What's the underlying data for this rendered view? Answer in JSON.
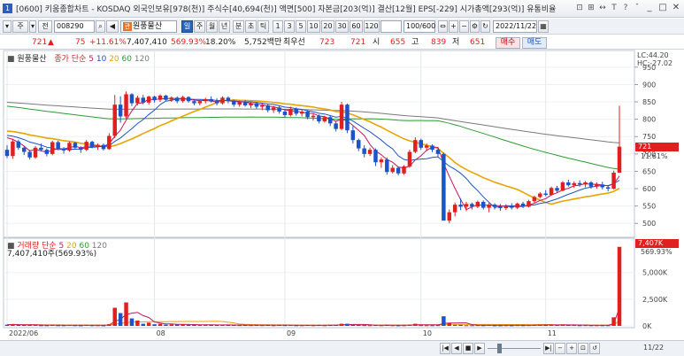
{
  "window": {
    "app_num": "1",
    "title": "[0600] 키움종합차트 - KOSDAQ 외국인보유[978(천)]  주식수[40,694(천)]  액면[500]  자본금[203(억)]  결산[12월]  EPS[-229]  시가총액[293(억)]  유통비율",
    "ctrl_icons": [
      "⊡",
      "⊞",
      "↔",
      "T",
      "?",
      "ˇ"
    ],
    "win_buttons": [
      "_",
      "□",
      "✕"
    ]
  },
  "toolbar": {
    "type_btn": "주",
    "prev_btn": "전",
    "code": "008290",
    "stock_badge": "관",
    "stock_name": "원풍물산",
    "periods": [
      "일",
      "주",
      "월",
      "년",
      "분",
      "초",
      "틱"
    ],
    "active_period": "일",
    "intervals": [
      "1",
      "3",
      "5",
      "10",
      "20",
      "30",
      "60",
      "120"
    ],
    "count": "100/600",
    "date": "2022/11/22"
  },
  "quote": {
    "price": "721",
    "arrow": "▲",
    "change": "75",
    "change_pct": "+11.61%",
    "volume": "7,407,410",
    "volume_pct": "569.93%",
    "turnover": "18.20%",
    "amount": "5,752백만",
    "priority": "최우선",
    "ask": "723",
    "bid": "721",
    "open_label": "시",
    "open": "655",
    "high_label": "고",
    "high": "839",
    "low_label": "저",
    "low": "651",
    "buy_btn": "매수",
    "sell_btn": "매도"
  },
  "price_panel": {
    "stock_label": "원풍물산",
    "legend_prefix": "종가 단순",
    "ma_periods": [
      "5",
      "10",
      "20",
      "60",
      "120"
    ],
    "lc": "LC:44.20",
    "hc": "HC:-27.02",
    "current_tag": "721",
    "current_pct": "11.61%",
    "y_ticks": [
      "950",
      "900",
      "850",
      "800",
      "750",
      "700",
      "650",
      "600",
      "550",
      "500"
    ]
  },
  "volume_panel": {
    "legend_prefix": "거래량 단순",
    "ma_periods": [
      "5",
      "20",
      "60",
      "120"
    ],
    "value_line": "7,407,410주(569.93%)",
    "current_tag": "7,407K",
    "current_pct": "569.93%",
    "y_ticks": [
      "5,000K",
      "2,500K",
      "0K"
    ]
  },
  "x_axis": {
    "labels": [
      {
        "text": "2022/06",
        "idx": 0
      },
      {
        "text": "08",
        "idx": 26
      },
      {
        "text": "09",
        "idx": 49
      },
      {
        "text": "10",
        "idx": 73
      },
      {
        "text": "11",
        "idx": 95
      }
    ],
    "right_label": "11/22"
  },
  "colors": {
    "up": "#e02020",
    "down": "#1b53c8",
    "ma5": "#c2185b",
    "ma10": "#1b53c8",
    "ma20": "#e8a400",
    "ma60": "#2e9b34",
    "ma120": "#7a7a7a"
  },
  "chart_data": {
    "type": "candlestick",
    "ylim": [
      470,
      970
    ],
    "volume_ylim": [
      0,
      7800000
    ],
    "ohlc": [
      [
        712,
        725,
        688,
        694
      ],
      [
        694,
        744,
        686,
        736
      ],
      [
        736,
        741,
        712,
        718
      ],
      [
        718,
        722,
        697,
        706
      ],
      [
        706,
        712,
        684,
        690
      ],
      [
        690,
        723,
        686,
        718
      ],
      [
        718,
        730,
        708,
        712
      ],
      [
        712,
        716,
        693,
        700
      ],
      [
        700,
        738,
        696,
        734
      ],
      [
        734,
        738,
        712,
        716
      ],
      [
        716,
        720,
        701,
        710
      ],
      [
        710,
        736,
        706,
        732
      ],
      [
        732,
        735,
        714,
        718
      ],
      [
        718,
        722,
        703,
        712
      ],
      [
        712,
        740,
        708,
        735
      ],
      [
        735,
        738,
        716,
        720
      ],
      [
        720,
        730,
        712,
        726
      ],
      [
        726,
        730,
        710,
        714
      ],
      [
        714,
        760,
        712,
        752
      ],
      [
        752,
        870,
        745,
        842
      ],
      [
        842,
        866,
        790,
        808
      ],
      [
        808,
        880,
        802,
        872
      ],
      [
        872,
        875,
        838,
        846
      ],
      [
        846,
        868,
        840,
        862
      ],
      [
        862,
        870,
        843,
        848
      ],
      [
        848,
        868,
        842,
        865
      ],
      [
        865,
        868,
        848,
        856
      ],
      [
        856,
        872,
        850,
        868
      ],
      [
        868,
        871,
        852,
        856
      ],
      [
        856,
        866,
        850,
        862
      ],
      [
        862,
        866,
        846,
        852
      ],
      [
        852,
        868,
        848,
        864
      ],
      [
        864,
        866,
        848,
        852
      ],
      [
        852,
        858,
        840,
        846
      ],
      [
        846,
        856,
        840,
        852
      ],
      [
        852,
        862,
        846,
        858
      ],
      [
        858,
        866,
        848,
        852
      ],
      [
        852,
        860,
        840,
        846
      ],
      [
        846,
        866,
        842,
        862
      ],
      [
        862,
        866,
        846,
        852
      ],
      [
        852,
        856,
        836,
        842
      ],
      [
        842,
        854,
        836,
        850
      ],
      [
        850,
        855,
        836,
        840
      ],
      [
        840,
        850,
        832,
        846
      ],
      [
        846,
        850,
        830,
        836
      ],
      [
        836,
        846,
        826,
        840
      ],
      [
        840,
        844,
        820,
        826
      ],
      [
        826,
        838,
        818,
        834
      ],
      [
        834,
        840,
        816,
        822
      ],
      [
        822,
        830,
        804,
        812
      ],
      [
        812,
        836,
        808,
        830
      ],
      [
        830,
        834,
        810,
        816
      ],
      [
        816,
        828,
        808,
        822
      ],
      [
        822,
        826,
        800,
        806
      ],
      [
        806,
        818,
        796,
        810
      ],
      [
        810,
        814,
        788,
        794
      ],
      [
        794,
        810,
        790,
        806
      ],
      [
        806,
        810,
        780,
        788
      ],
      [
        788,
        795,
        765,
        772
      ],
      [
        772,
        850,
        768,
        842
      ],
      [
        842,
        845,
        760,
        768
      ],
      [
        768,
        780,
        730,
        740
      ],
      [
        740,
        744,
        708,
        716
      ],
      [
        716,
        725,
        690,
        700
      ],
      [
        700,
        718,
        694,
        712
      ],
      [
        712,
        716,
        665,
        676
      ],
      [
        676,
        690,
        660,
        684
      ],
      [
        684,
        690,
        640,
        648
      ],
      [
        648,
        668,
        644,
        660
      ],
      [
        660,
        664,
        638,
        644
      ],
      [
        644,
        668,
        640,
        664
      ],
      [
        664,
        712,
        660,
        706
      ],
      [
        706,
        748,
        702,
        740
      ],
      [
        740,
        744,
        712,
        718
      ],
      [
        718,
        730,
        708,
        724
      ],
      [
        724,
        728,
        705,
        712
      ],
      [
        712,
        716,
        690,
        700
      ],
      [
        700,
        704,
        560,
        508
      ],
      [
        508,
        540,
        500,
        532
      ],
      [
        532,
        560,
        520,
        554
      ],
      [
        554,
        572,
        538,
        548
      ],
      [
        548,
        562,
        535,
        556
      ],
      [
        556,
        560,
        540,
        548
      ],
      [
        548,
        566,
        544,
        562
      ],
      [
        562,
        566,
        540,
        545
      ],
      [
        545,
        560,
        532,
        554
      ],
      [
        554,
        558,
        540,
        548
      ],
      [
        548,
        556,
        536,
        544
      ],
      [
        544,
        555,
        538,
        550
      ],
      [
        550,
        558,
        540,
        545
      ],
      [
        545,
        560,
        541,
        557
      ],
      [
        557,
        562,
        544,
        548
      ],
      [
        548,
        568,
        546,
        564
      ],
      [
        564,
        580,
        560,
        576
      ],
      [
        576,
        590,
        572,
        586
      ],
      [
        586,
        596,
        578,
        582
      ],
      [
        582,
        606,
        580,
        602
      ],
      [
        602,
        608,
        588,
        594
      ],
      [
        594,
        622,
        592,
        618
      ],
      [
        618,
        626,
        606,
        610
      ],
      [
        610,
        621,
        602,
        616
      ],
      [
        616,
        624,
        606,
        612
      ],
      [
        612,
        622,
        604,
        618
      ],
      [
        618,
        622,
        600,
        606
      ],
      [
        606,
        618,
        600,
        612
      ],
      [
        612,
        620,
        598,
        604
      ],
      [
        604,
        610,
        592,
        600
      ],
      [
        600,
        652,
        598,
        646
      ],
      [
        646,
        839,
        651,
        721
      ]
    ],
    "volume": [
      110000,
      160000,
      90000,
      80000,
      80000,
      100000,
      60000,
      60000,
      90000,
      60000,
      60000,
      80000,
      60000,
      50000,
      90000,
      60000,
      60000,
      50000,
      160000,
      1700000,
      1200000,
      2200000,
      700000,
      500000,
      200000,
      300000,
      150000,
      200000,
      120000,
      150000,
      120000,
      160000,
      110000,
      90000,
      80000,
      110000,
      90000,
      80000,
      100000,
      80000,
      80000,
      70000,
      80000,
      70000,
      80000,
      70000,
      80000,
      60000,
      80000,
      70000,
      80000,
      60000,
      60000,
      80000,
      60000,
      80000,
      60000,
      80000,
      90000,
      200000,
      200000,
      100000,
      80000,
      70000,
      60000,
      80000,
      60000,
      90000,
      60000,
      50000,
      60000,
      120000,
      200000,
      70000,
      60000,
      60000,
      70000,
      900000,
      250000,
      100000,
      100000,
      60000,
      60000,
      70000,
      60000,
      80000,
      50000,
      50000,
      60000,
      50000,
      70000,
      60000,
      70000,
      100000,
      110000,
      80000,
      100000,
      80000,
      130000,
      80000,
      80000,
      60000,
      70000,
      60000,
      60000,
      60000,
      60000,
      800000,
      7407410
    ]
  }
}
